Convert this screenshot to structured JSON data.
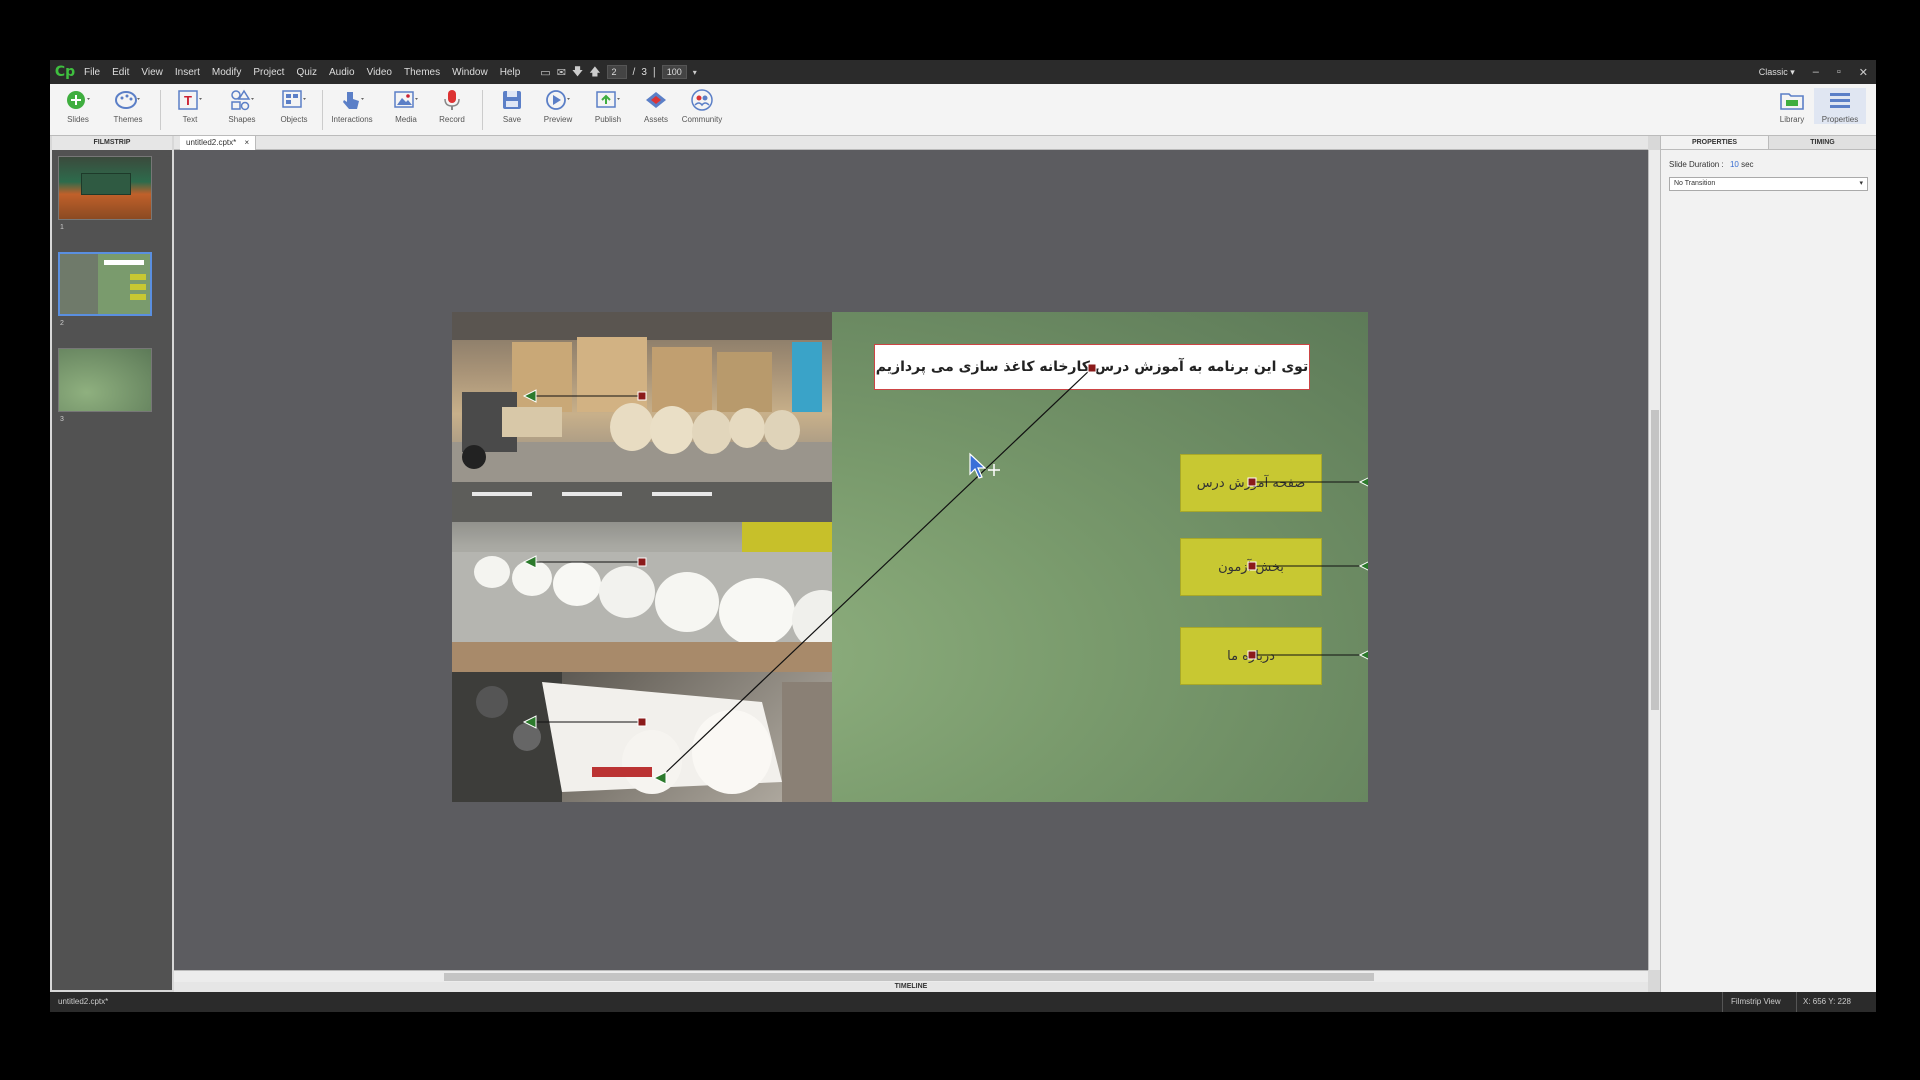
{
  "app": {
    "logo": "Cp",
    "menus": [
      "File",
      "Edit",
      "View",
      "Insert",
      "Modify",
      "Project",
      "Quiz",
      "Audio",
      "Video",
      "Themes",
      "Window",
      "Help"
    ],
    "slide_current": "2",
    "slide_sep": "/",
    "slide_total": "3",
    "zoom": "100",
    "workspace": "Classic"
  },
  "toolbar": {
    "slides": "Slides",
    "themes": "Themes",
    "text": "Text",
    "shapes": "Shapes",
    "objects": "Objects",
    "interactions": "Interactions",
    "media": "Media",
    "record": "Record",
    "save": "Save",
    "preview": "Preview",
    "publish": "Publish",
    "assets": "Assets",
    "community": "Community",
    "library": "Library",
    "properties": "Properties"
  },
  "filmstrip": {
    "header": "FILMSTRIP",
    "items": [
      {
        "num": "1"
      },
      {
        "num": "2"
      },
      {
        "num": "3"
      }
    ]
  },
  "document": {
    "tab_label": "untitled2.cptx*",
    "tab_close": "×"
  },
  "slide": {
    "title": "توی این برنامه به آموزش درس کارخانه کاغذ سازی می پردازیم",
    "buttons": [
      {
        "label": "صفحه آموزش درس"
      },
      {
        "label": "بخش آزمون"
      },
      {
        "label": "درباره ما"
      }
    ]
  },
  "timeline": {
    "label": "TIMELINE"
  },
  "properties_panel": {
    "tab_properties": "PROPERTIES",
    "tab_timing": "TIMING",
    "slide_duration_label": "Slide Duration :",
    "slide_duration_value": "10",
    "slide_duration_unit": "sec",
    "transition": "No Transition"
  },
  "statusbar": {
    "file": "untitled2.cptx*",
    "view": "Filmstrip View",
    "coords": "X: 656 Y: 228"
  },
  "colors": {
    "accent": "#5a8fe0",
    "button_yellow": "#c8c832",
    "handle_red": "#8b1a1a",
    "stage": "#5c5c60"
  }
}
